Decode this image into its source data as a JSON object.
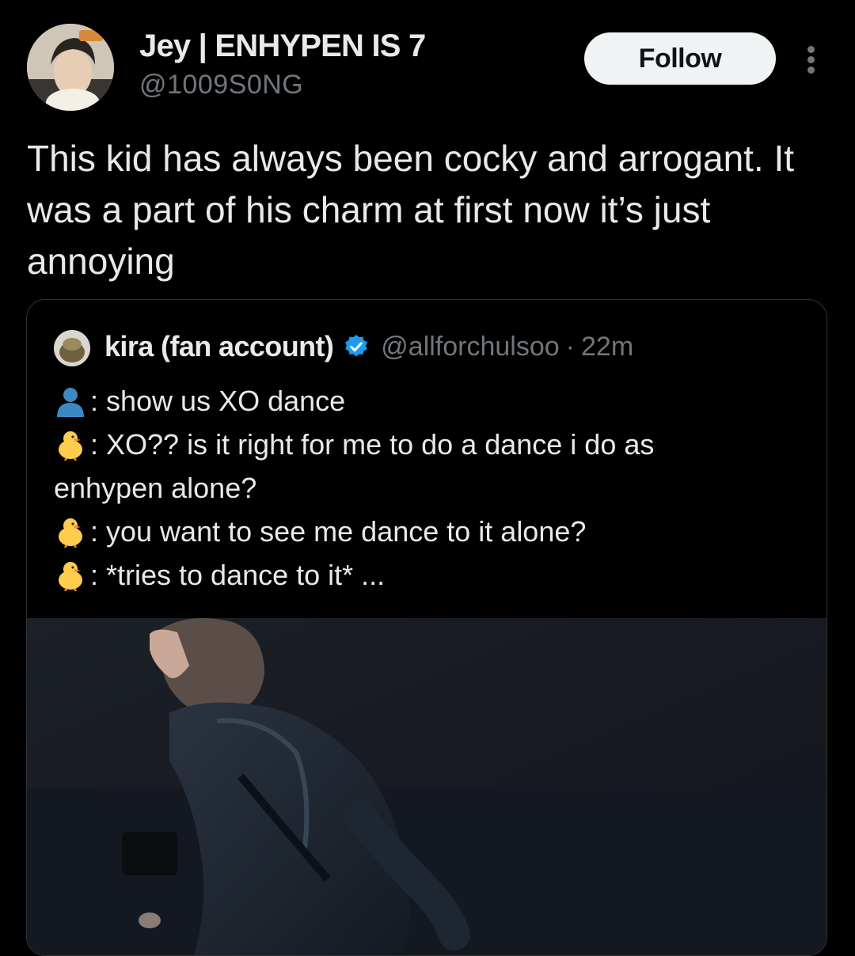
{
  "author": {
    "name": "Jey | ENHYPEN IS 7",
    "handle": "@1009S0NG",
    "avatar": "profile-photo"
  },
  "actions": {
    "follow_label": "Follow",
    "more_icon": "more-vertical-icon"
  },
  "tweet": {
    "text": "This kid has always been cocky and arrogant. It was a part of his charm at first now it’s just annoying"
  },
  "quoted": {
    "name": "kira (fan account)",
    "verified_icon": "verified-badge-icon",
    "handle": "@allforchulsoo",
    "separator": "·",
    "time": "22m",
    "lines": [
      {
        "emoji": "bust-in-silhouette-icon",
        "text": ": show us XO dance"
      },
      {
        "emoji": "chick-icon",
        "text": ": XO?? is it right for me to do a dance i do as"
      },
      {
        "emoji": "",
        "text": "enhypen alone?"
      },
      {
        "emoji": "chick-icon",
        "text": ": you want to see me dance to it alone?"
      },
      {
        "emoji": "chick-icon",
        "text": ": *tries to dance to it* ..."
      }
    ],
    "media": "video-thumbnail-dancer-in-hoodie"
  },
  "colors": {
    "background": "#000000",
    "text_primary": "#e7e9ea",
    "text_secondary": "#71767b",
    "border": "#2f3336",
    "verified": "#1d9bf0",
    "follow_bg": "#eff3f4",
    "follow_text": "#0f1419"
  }
}
